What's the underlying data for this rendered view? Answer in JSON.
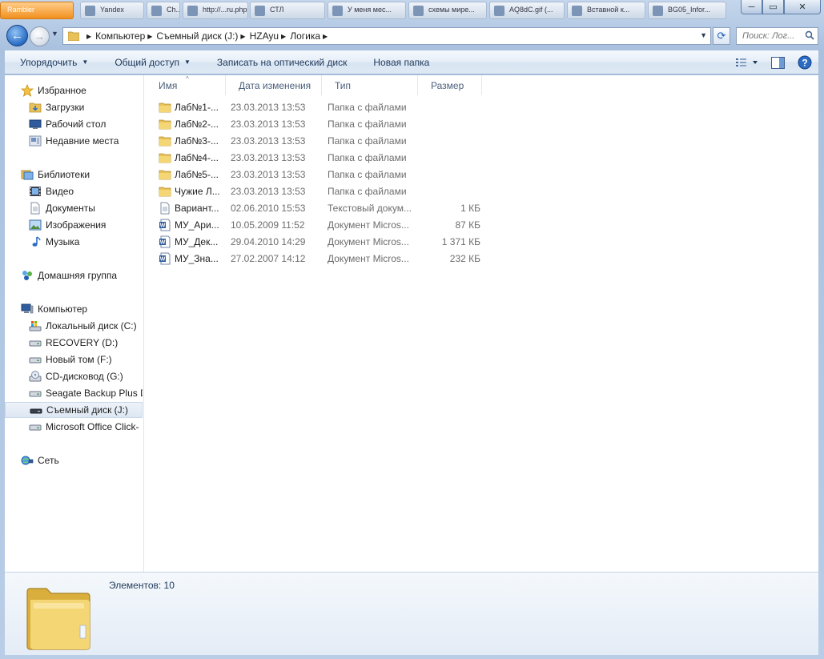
{
  "window": {
    "tabs": [
      {
        "label": "Rambler",
        "style": "orange"
      },
      {
        "label": "Yandex",
        "style": ""
      },
      {
        "label": "Ch...",
        "style": ""
      },
      {
        "label": "http://...ru.php",
        "style": ""
      },
      {
        "label": "СТЛ",
        "style": ""
      },
      {
        "label": "У меня мес...",
        "style": ""
      },
      {
        "label": "схемы мире...",
        "style": ""
      },
      {
        "label": "AQ8dC.gif (...",
        "style": ""
      },
      {
        "label": "Вставной к...",
        "style": ""
      },
      {
        "label": "BG05_Infor...",
        "style": ""
      }
    ],
    "minimize": "─",
    "maximize": "▭",
    "close": "✕"
  },
  "address": {
    "crumbs": [
      "Компьютер",
      "Съемный диск (J:)",
      "HZAyu",
      "Логика"
    ]
  },
  "search": {
    "placeholder": "Поиск: Лог..."
  },
  "toolbar": {
    "organize": "Упорядочить",
    "share": "Общий доступ",
    "burn": "Записать на оптический диск",
    "new_folder": "Новая папка"
  },
  "nav": {
    "favorites": "Избранное",
    "downloads": "Загрузки",
    "desktop": "Рабочий стол",
    "recent": "Недавние места",
    "libraries": "Библиотеки",
    "video": "Видео",
    "documents": "Документы",
    "pictures": "Изображения",
    "music": "Музыка",
    "homegroup": "Домашняя группа",
    "computer": "Компьютер",
    "drive_c": "Локальный диск (C:)",
    "drive_d": "RECOVERY (D:)",
    "drive_f": "Новый том (F:)",
    "drive_g": "CD-дисковод (G:)",
    "drive_seagate": "Seagate Backup Plus D",
    "drive_j": "Съемный диск (J:)",
    "drive_office": "Microsoft Office Click-",
    "network": "Сеть"
  },
  "columns": {
    "name": "Имя",
    "date": "Дата изменения",
    "type": "Тип",
    "size": "Размер"
  },
  "files": [
    {
      "name": "Лаб№1-...",
      "date": "23.03.2013 13:53",
      "type": "Папка с файлами",
      "size": "",
      "kind": "folder"
    },
    {
      "name": "Лаб№2-...",
      "date": "23.03.2013 13:53",
      "type": "Папка с файлами",
      "size": "",
      "kind": "folder"
    },
    {
      "name": "Лаб№3-...",
      "date": "23.03.2013 13:53",
      "type": "Папка с файлами",
      "size": "",
      "kind": "folder"
    },
    {
      "name": "Лаб№4-...",
      "date": "23.03.2013 13:53",
      "type": "Папка с файлами",
      "size": "",
      "kind": "folder"
    },
    {
      "name": "Лаб№5-...",
      "date": "23.03.2013 13:53",
      "type": "Папка с файлами",
      "size": "",
      "kind": "folder"
    },
    {
      "name": "Чужие Л...",
      "date": "23.03.2013 13:53",
      "type": "Папка с файлами",
      "size": "",
      "kind": "folder"
    },
    {
      "name": "Вариант...",
      "date": "02.06.2010 15:53",
      "type": "Текстовый докум...",
      "size": "1 КБ",
      "kind": "text"
    },
    {
      "name": "МУ_Ари...",
      "date": "10.05.2009 11:52",
      "type": "Документ Micros...",
      "size": "87 КБ",
      "kind": "word"
    },
    {
      "name": "МУ_Дек...",
      "date": "29.04.2010 14:29",
      "type": "Документ Micros...",
      "size": "1 371 КБ",
      "kind": "word"
    },
    {
      "name": "МУ_Зна...",
      "date": "27.02.2007 14:12",
      "type": "Документ Micros...",
      "size": "232 КБ",
      "kind": "word"
    }
  ],
  "details": {
    "count": "Элементов: 10"
  }
}
